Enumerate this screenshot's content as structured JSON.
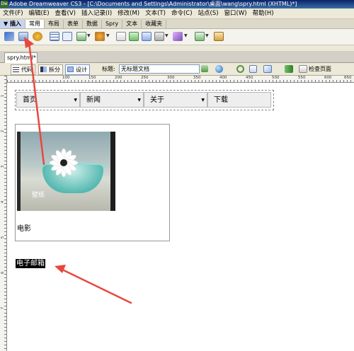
{
  "titlebar": {
    "icon": "Dw",
    "text": "Adobe Dreamweaver CS3 - [C:\\Documents and Settings\\Administrator\\桌面\\wang\\spry.html (XHTML)*]"
  },
  "menubar": [
    "文件(F)",
    "编辑(E)",
    "查看(V)",
    "插入记录(I)",
    "修改(M)",
    "文本(T)",
    "命令(C)",
    "站点(S)",
    "窗口(W)",
    "帮助(H)"
  ],
  "insertbar": {
    "tabs": [
      "▼ 插入",
      "常用",
      "布局",
      "表单",
      "数据",
      "Spry",
      "文本",
      "收藏夹"
    ],
    "active_index": 1
  },
  "doc_tab": "spry.html*",
  "doc_toolbar": {
    "code": "代码",
    "split": "拆分",
    "design": "设计",
    "title_label": "标题:",
    "title_value": "无标题文档",
    "check_page": "检查页面"
  },
  "ruler": {
    "h_ticks": [
      "100",
      "150",
      "200",
      "250",
      "300",
      "350",
      "400",
      "450",
      "500",
      "550",
      "600",
      "650"
    ],
    "v_ticks": [
      "1",
      "2",
      "3",
      "4",
      "5",
      "6",
      "7"
    ]
  },
  "design": {
    "menu_items": [
      {
        "label": "首页",
        "has_submenu": true
      },
      {
        "label": "新闻",
        "has_submenu": true
      },
      {
        "label": "关于",
        "has_submenu": true
      },
      {
        "label": "下载",
        "has_submenu": false
      }
    ],
    "photo_caption": "壁纸",
    "submenu_item": "电影",
    "selected_text": "电子邮箱"
  },
  "colors": {
    "annotation_arrow": "#e8473f",
    "selection_bg": "#000000"
  }
}
